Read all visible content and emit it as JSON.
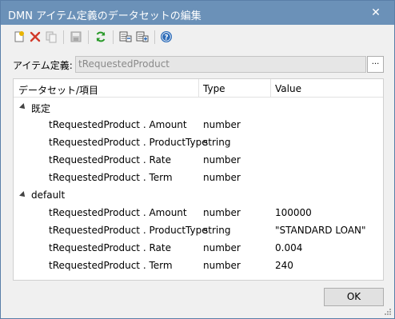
{
  "window": {
    "title": "DMN アイテム定義のデータセットの編集",
    "close_label": "✕"
  },
  "toolbar": {
    "icons": [
      "new-icon",
      "delete-icon",
      "copy-icon",
      "save-icon",
      "refresh-icon",
      "import-icon",
      "export-icon",
      "help-icon"
    ],
    "colors": {
      "new": "#e8b400",
      "delete": "#d23a2a",
      "refresh": "#2a9a2a",
      "help": "#2c6bb8",
      "disabled": "#b0b0b0"
    }
  },
  "item_definition": {
    "label": "アイテム定義:",
    "value": "tRequestedProduct",
    "browse_label": "..."
  },
  "table": {
    "headers": {
      "dataset": "データセット/項目",
      "type": "Type",
      "value": "Value"
    },
    "groups": [
      {
        "name": "既定",
        "rows": [
          {
            "item": "tRequestedProduct . Amount",
            "type": "number",
            "value": ""
          },
          {
            "item": "tRequestedProduct . ProductType",
            "type": "string",
            "value": ""
          },
          {
            "item": "tRequestedProduct . Rate",
            "type": "number",
            "value": ""
          },
          {
            "item": "tRequestedProduct . Term",
            "type": "number",
            "value": ""
          }
        ]
      },
      {
        "name": "default",
        "rows": [
          {
            "item": "tRequestedProduct . Amount",
            "type": "number",
            "value": "100000"
          },
          {
            "item": "tRequestedProduct . ProductType",
            "type": "string",
            "value": "\"STANDARD LOAN\""
          },
          {
            "item": "tRequestedProduct . Rate",
            "type": "number",
            "value": "0.004"
          },
          {
            "item": "tRequestedProduct . Term",
            "type": "number",
            "value": "240"
          }
        ]
      }
    ]
  },
  "footer": {
    "ok_label": "OK"
  }
}
